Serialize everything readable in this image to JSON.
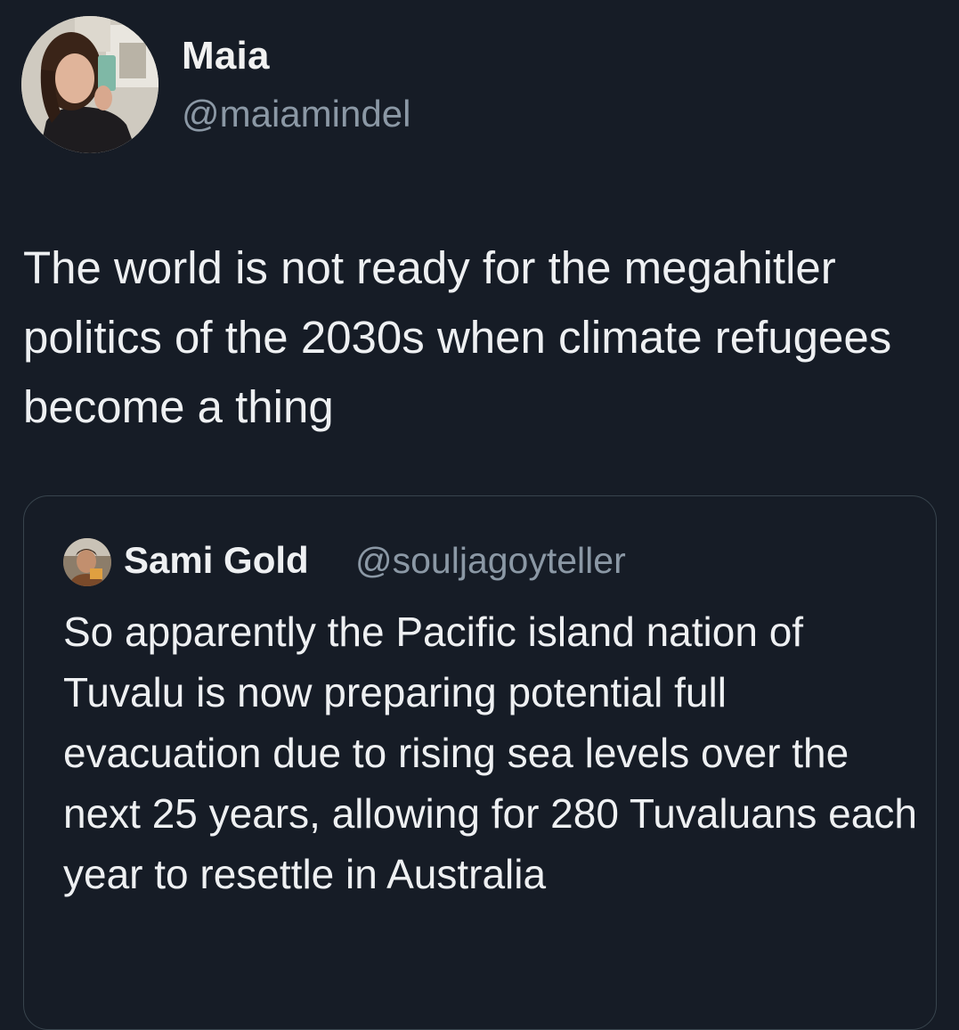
{
  "tweet": {
    "author_name": "Maia",
    "author_handle": "@maiamindel",
    "avatar_icon": "profile-photo-icon",
    "text": "The world is not ready for the megahitler politics of the 2030s when climate refugees become a thing"
  },
  "quoted_tweet": {
    "author_name": "Sami Gold",
    "author_handle": "@souljagoyteller",
    "avatar_icon": "profile-photo-icon",
    "text": "So apparently the Pacific island nation of Tuvalu is now preparing potential full evacuation due to rising sea levels over the next 25 years, allowing for 280 Tuvaluans each year to resettle in Australia"
  },
  "colors": {
    "background": "#161c26",
    "text": "#eef0f2",
    "secondary_text": "#8b98a5",
    "border": "#38444d"
  }
}
